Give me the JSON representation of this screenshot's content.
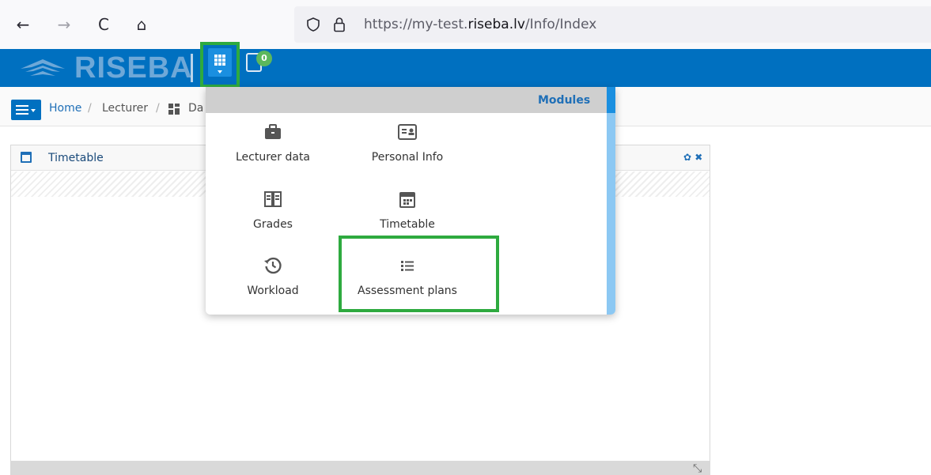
{
  "browser": {
    "back_glyph": "←",
    "forward_glyph": "→",
    "reload_glyph": "C",
    "home_glyph": "⌂",
    "url_prefix": "https://my-test.",
    "url_domain": "riseba.lv",
    "url_path": "/Info/Index"
  },
  "header": {
    "logo_text": "RISEBA",
    "notification_count": "0",
    "colors": {
      "bar": "#0070c0",
      "highlight": "#2eaa3f"
    }
  },
  "breadcrumb": {
    "home": "Home",
    "sep1": "/",
    "lecturer": "Lecturer",
    "sep2": "/",
    "current": "Da"
  },
  "widget": {
    "title": "Timetable",
    "tools": "✿ ✖"
  },
  "modules": {
    "title": "Modules",
    "items": [
      {
        "label": "Lecturer data",
        "icon": "briefcase-icon"
      },
      {
        "label": "Personal Info",
        "icon": "id-card-icon"
      },
      {
        "label": "Grades",
        "icon": "book-icon"
      },
      {
        "label": "Timetable",
        "icon": "calendar-icon"
      },
      {
        "label": "Workload",
        "icon": "history-icon"
      },
      {
        "label": "Assessment plans",
        "icon": "list-icon"
      }
    ]
  }
}
